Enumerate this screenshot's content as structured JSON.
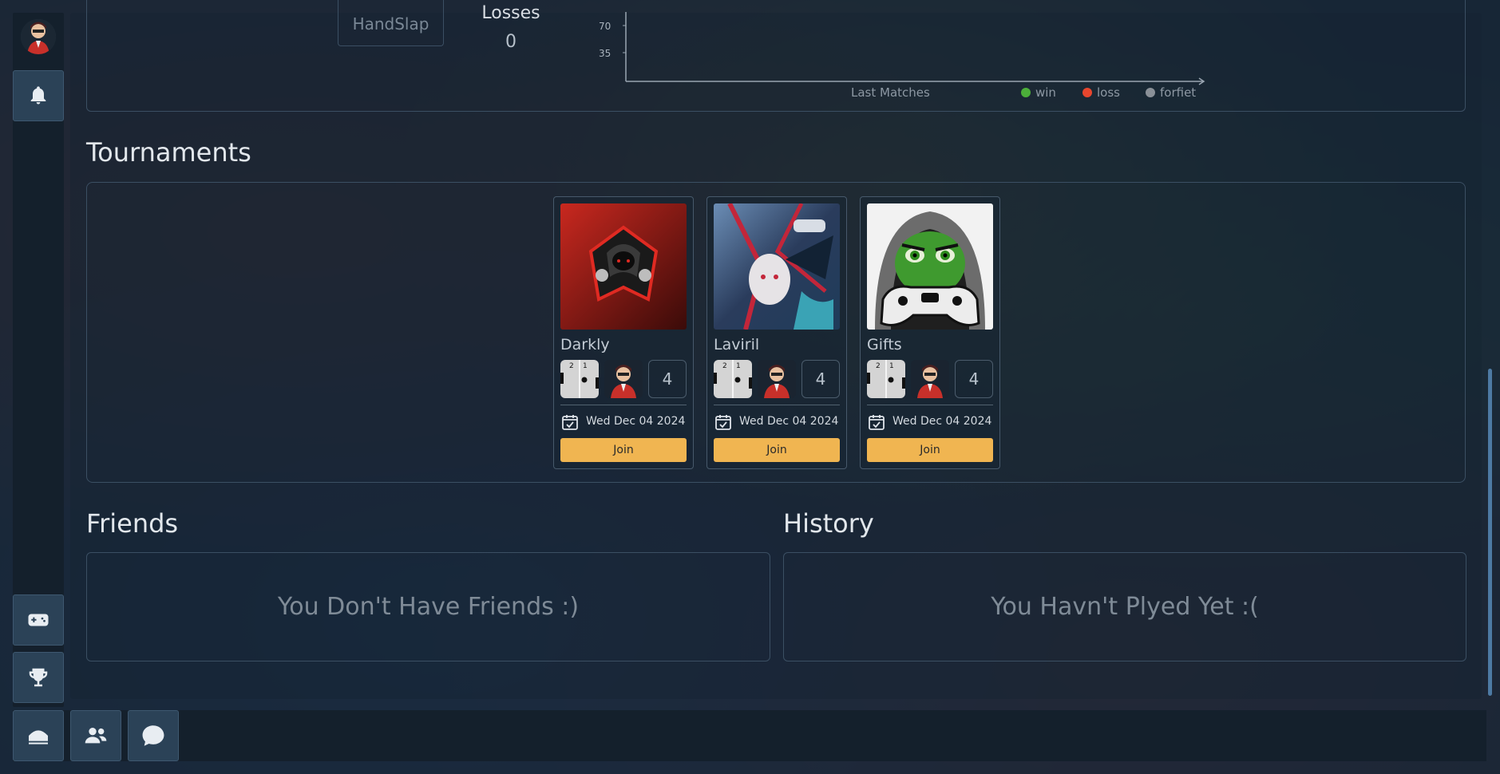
{
  "stats": {
    "mode_label": "HandSlap",
    "losses_label": "Losses",
    "losses_value": "0"
  },
  "chart_data": {
    "type": "line",
    "xlabel": "Last Matches",
    "yticks": [
      70,
      35
    ],
    "series": [],
    "legend": [
      {
        "name": "win",
        "color": "#4caf3a"
      },
      {
        "name": "loss",
        "color": "#e8462e"
      },
      {
        "name": "forfiet",
        "color": "#8a9097"
      }
    ]
  },
  "tournaments": {
    "title": "Tournaments",
    "cards": [
      {
        "name": "Darkly",
        "count": "4",
        "date": "Wed Dec 04 2024",
        "join": "Join"
      },
      {
        "name": "Laviril",
        "count": "4",
        "date": "Wed Dec 04 2024",
        "join": "Join"
      },
      {
        "name": "Gifts",
        "count": "4",
        "date": "Wed Dec 04 2024",
        "join": "Join"
      }
    ]
  },
  "friends": {
    "title": "Friends",
    "empty": "You Don't Have Friends :)"
  },
  "history": {
    "title": "History",
    "empty": "You Havn't Plyed Yet :("
  },
  "icons": {
    "sidebar": [
      "avatar",
      "bell-icon",
      "gamepad-icon",
      "trophy-icon"
    ],
    "bottom": [
      "home-icon",
      "users-icon",
      "chat-icon"
    ]
  }
}
